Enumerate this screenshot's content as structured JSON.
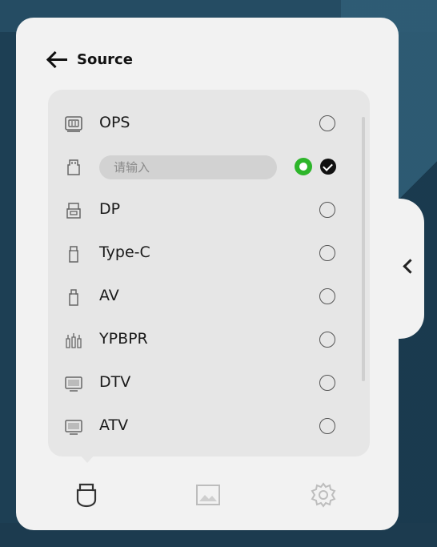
{
  "header": {
    "title": "Source"
  },
  "sources": [
    {
      "label": "OPS",
      "icon": "ops-box-icon"
    },
    {
      "label": "",
      "icon": "usb-plug-icon",
      "editing": true
    },
    {
      "label": "DP",
      "icon": "dp-port-icon"
    },
    {
      "label": "Type-C",
      "icon": "type-c-plug-icon"
    },
    {
      "label": "AV",
      "icon": "av-plug-icon"
    },
    {
      "label": "YPBPR",
      "icon": "component-cables-icon"
    },
    {
      "label": "DTV",
      "icon": "tv-screen-icon"
    },
    {
      "label": "ATV",
      "icon": "tv-screen-icon"
    }
  ],
  "rename": {
    "placeholder": "请输入"
  },
  "bottom_nav": [
    {
      "icon": "input-source-icon",
      "active": true
    },
    {
      "icon": "picture-icon",
      "active": false
    },
    {
      "icon": "settings-gear-icon",
      "active": false
    }
  ],
  "colors": {
    "panel": "#f2f2f2",
    "card": "#e6e6e6",
    "confirm": "#2db52a",
    "background": "#1d3f54"
  }
}
